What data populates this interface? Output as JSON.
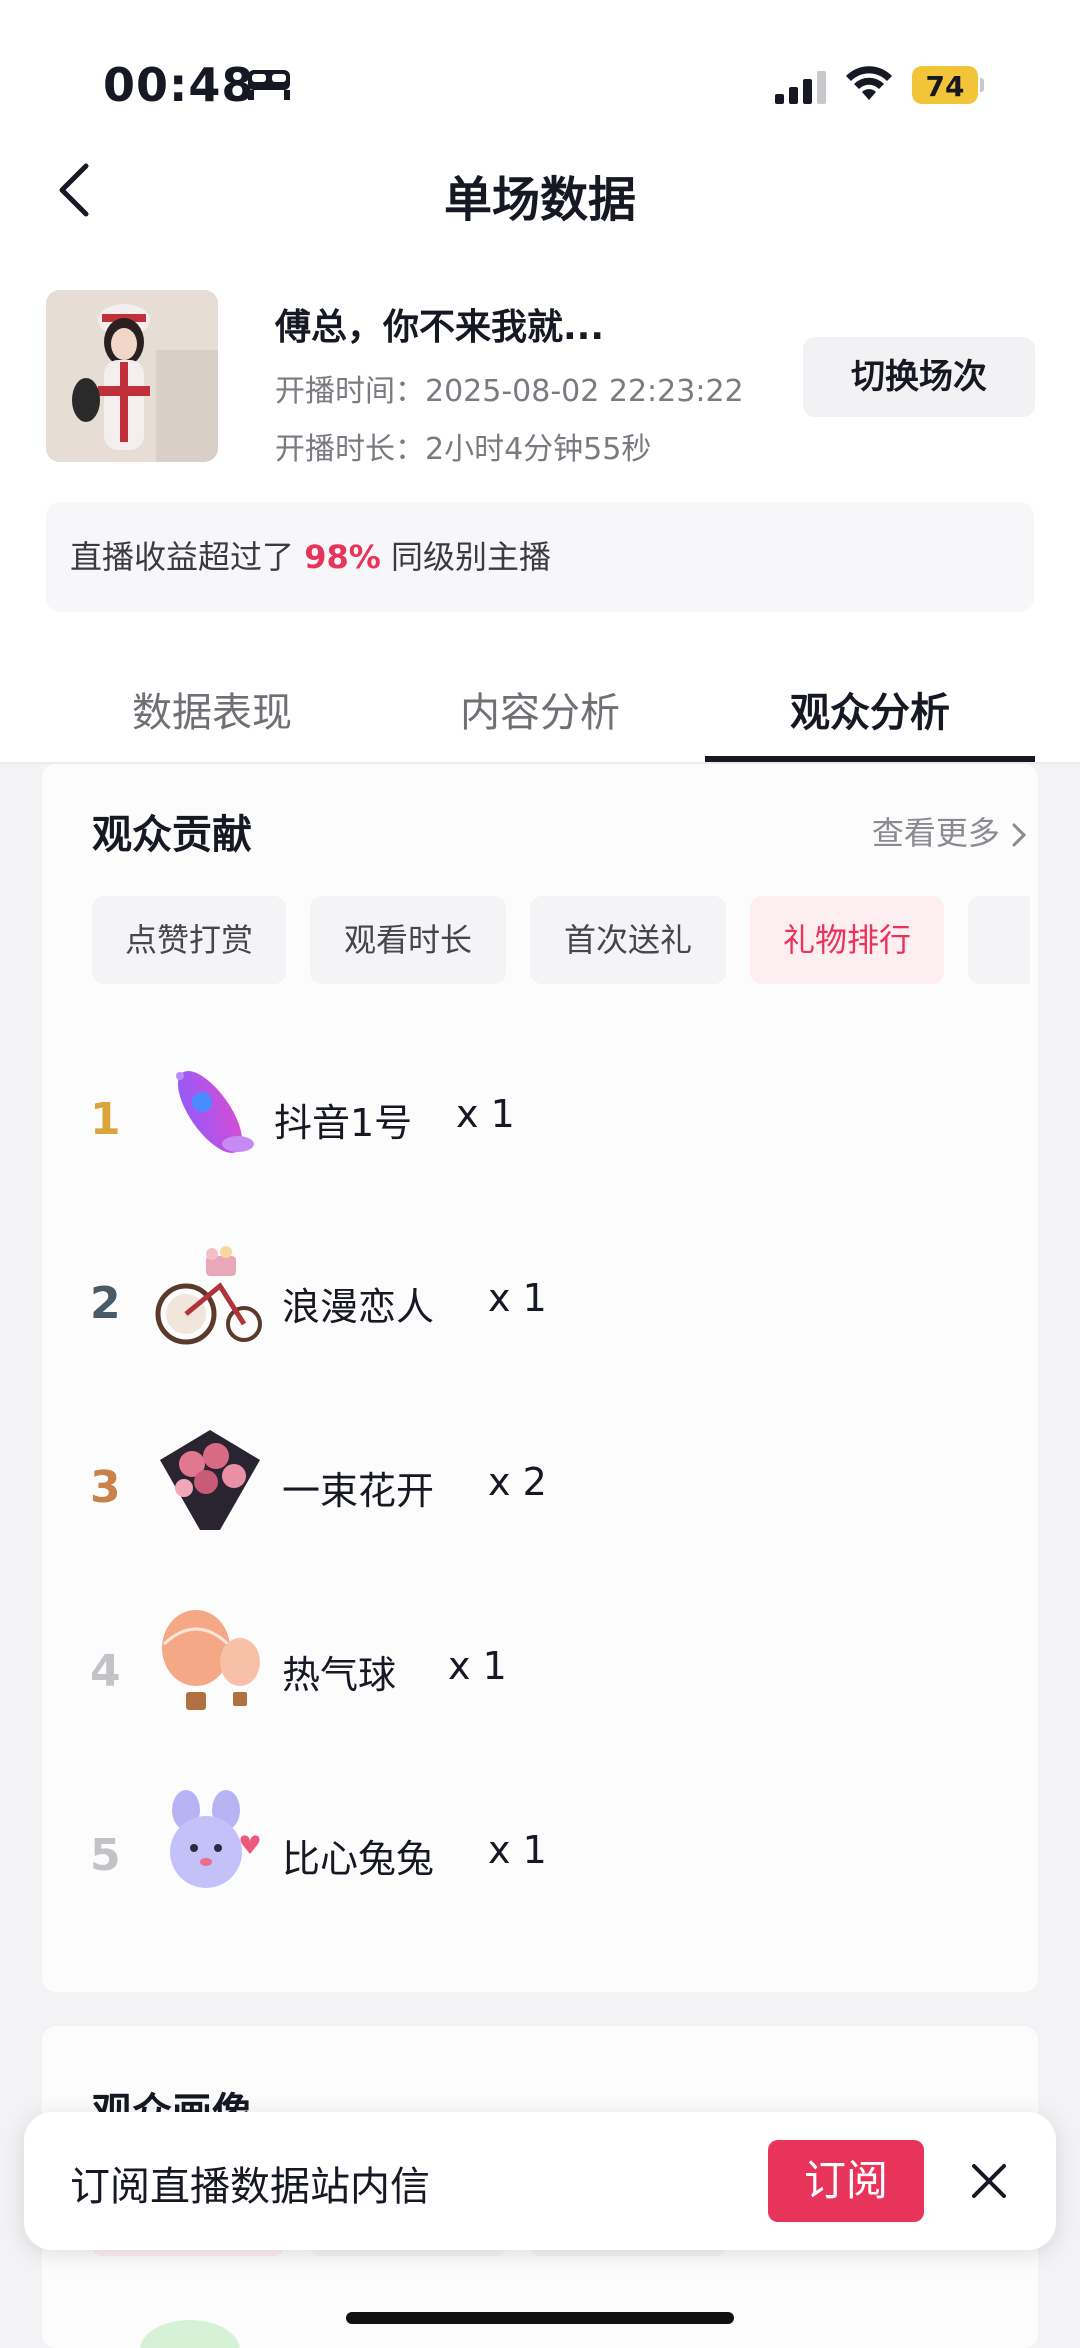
{
  "status_bar": {
    "time": "00:48",
    "battery": "74"
  },
  "header": {
    "title": "单场数据"
  },
  "stream": {
    "title": "傅总，你不来我就...",
    "start_label": "开播时间：",
    "start_value": "2025-08-02 22:23:22",
    "duration_label": "开播时长：",
    "duration_value": "2小时4分钟55秒",
    "switch_label": "切换场次"
  },
  "banner": {
    "prefix": "直播收益超过了 ",
    "percent": "98%",
    "suffix": " 同级别主播"
  },
  "tabs": [
    {
      "label": "数据表现"
    },
    {
      "label": "内容分析"
    },
    {
      "label": "观众分析"
    }
  ],
  "contribution": {
    "title": "观众贡献",
    "more_label": "查看更多",
    "chips": [
      {
        "label": "点赞打赏"
      },
      {
        "label": "观看时长"
      },
      {
        "label": "首次送礼"
      },
      {
        "label": "礼物排行"
      }
    ],
    "ranking": [
      {
        "rank": "1",
        "name": "抖音1号",
        "count": "x 1",
        "color": "#d9a53a"
      },
      {
        "rank": "2",
        "name": "浪漫恋人",
        "count": "x 1",
        "color": "#4a5a66"
      },
      {
        "rank": "3",
        "name": "一束花开",
        "count": "x 2",
        "color": "#c9824a"
      },
      {
        "rank": "4",
        "name": "热气球",
        "count": "x 1",
        "color": "#c2c3c7"
      },
      {
        "rank": "5",
        "name": "比心兔兔",
        "count": "x 1",
        "color": "#c2c3c7"
      }
    ]
  },
  "portrait": {
    "title": "观众画像"
  },
  "popup": {
    "text": "订阅直播数据站内信",
    "button_label": "订阅"
  },
  "colors": {
    "accent": "#e8345a",
    "battery": "#f2c438"
  }
}
